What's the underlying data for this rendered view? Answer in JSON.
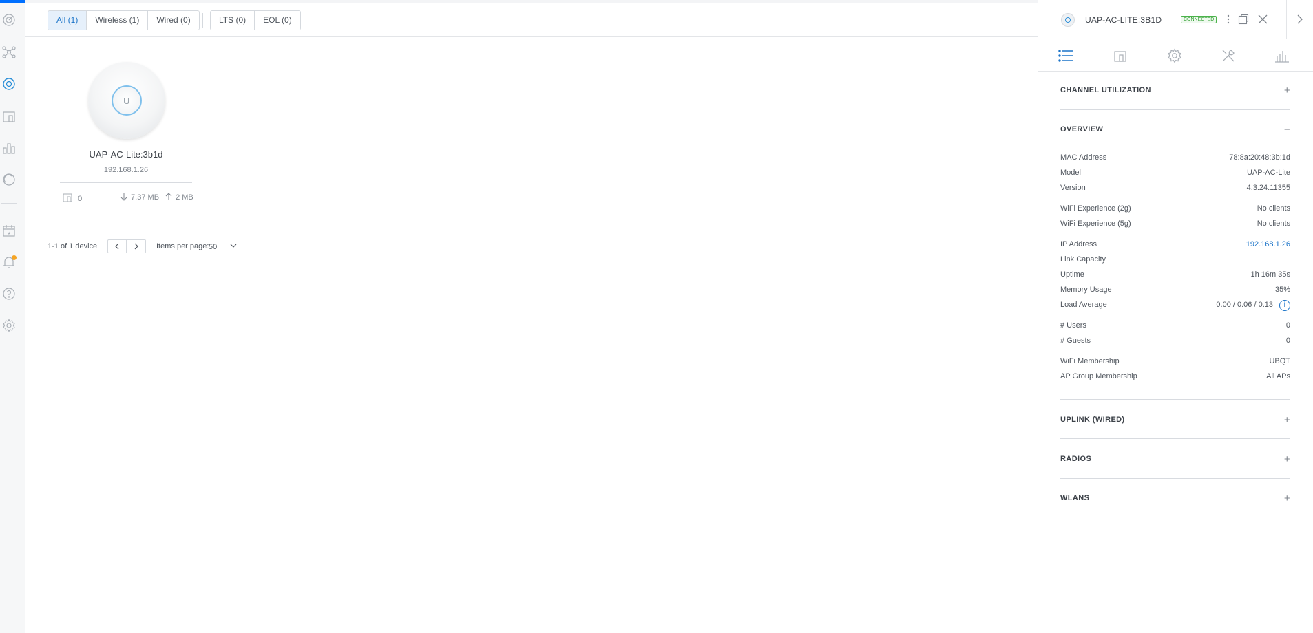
{
  "nav": {
    "items": [
      "dashboard-icon",
      "topology-icon",
      "devices-icon",
      "clients-icon",
      "statistics-icon",
      "insights-icon",
      "events-icon",
      "alerts-icon",
      "help-icon",
      "settings-icon"
    ],
    "accent": "#006fff",
    "alert_dot_color": "#f5a524"
  },
  "filters": {
    "type": [
      {
        "label": "All (1)",
        "active": true
      },
      {
        "label": "Wireless (1)",
        "active": false
      },
      {
        "label": "Wired (0)",
        "active": false
      }
    ],
    "firmware": [
      {
        "label": "LTS (0)"
      },
      {
        "label": "EOL (0)"
      }
    ]
  },
  "device": {
    "name": "UAP-AC-Lite:3b1d",
    "ip": "192.168.1.26",
    "clients": "0",
    "download": "7.37 MB",
    "upload": "2 MB",
    "logo_letter": "U"
  },
  "pagination": {
    "count": "1-1 of 1 device",
    "items_per_page_label": "Items per page:",
    "items_per_page": "50"
  },
  "panel": {
    "title": "UAP-AC-LITE:3B1D",
    "status": "CONNECTED",
    "status_color": "#4bb34b",
    "sections": {
      "channel": "CHANNEL UTILIZATION",
      "overview": "OVERVIEW",
      "uplink": "UPLINK (WIRED)",
      "radios": "RADIOS",
      "wlans": "WLANS"
    },
    "overview": {
      "mac_label": "MAC Address",
      "mac": "78:8a:20:48:3b:1d",
      "model_label": "Model",
      "model": "UAP-AC-Lite",
      "version_label": "Version",
      "version": "4.3.24.11355",
      "wifi2g_label": "WiFi Experience (2g)",
      "wifi2g": "No clients",
      "wifi5g_label": "WiFi Experience (5g)",
      "wifi5g": "No clients",
      "ip_label": "IP Address",
      "ip": "192.168.1.26",
      "link_label": "Link Capacity",
      "link": "",
      "uptime_label": "Uptime",
      "uptime": "1h 16m 35s",
      "memory_label": "Memory Usage",
      "memory": "35%",
      "load_label": "Load Average",
      "load": "0.00 / 0.06 / 0.13",
      "users_label": "# Users",
      "users": "0",
      "guests_label": "# Guests",
      "guests": "0",
      "wifi_membership_label": "WiFi Membership",
      "wifi_membership": "UBQT",
      "ap_group_label": "AP Group Membership",
      "ap_group": "All APs"
    }
  }
}
